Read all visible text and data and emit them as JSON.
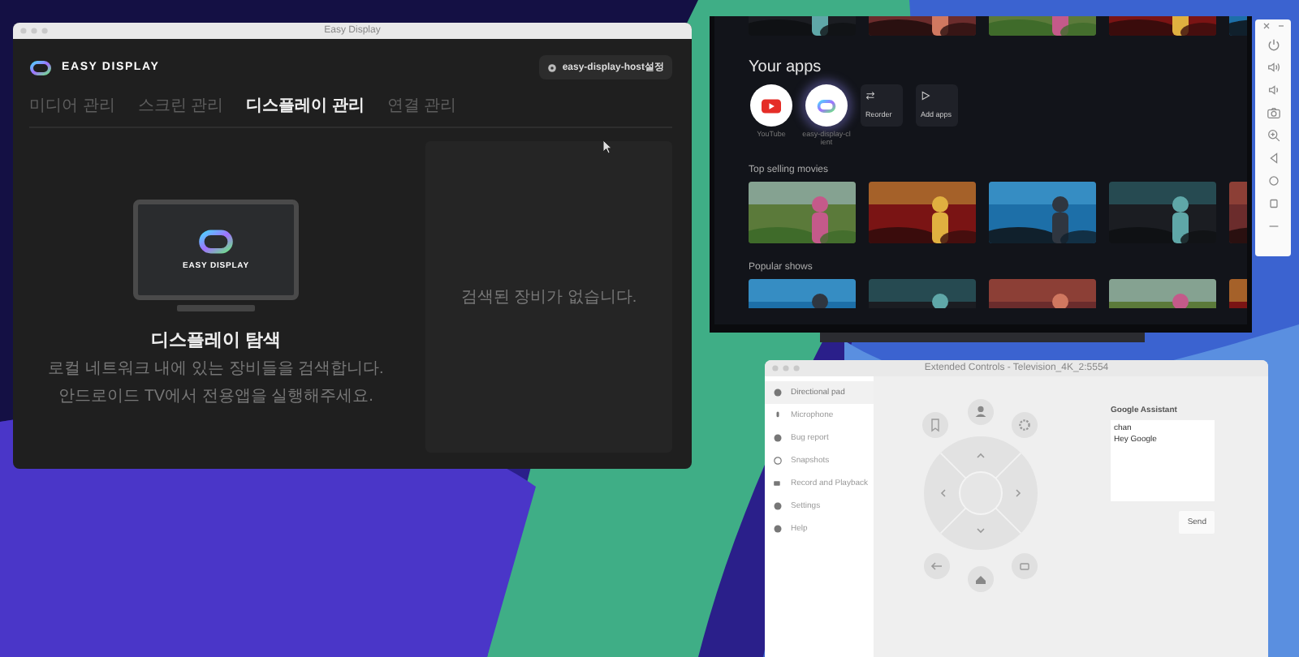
{
  "easy_display": {
    "title": "Easy Display",
    "brand": "EASY DISPLAY",
    "host_button": "easy-display-host설정",
    "tabs": [
      {
        "label": "미디어 관리",
        "selected": false
      },
      {
        "label": "스크린 관리",
        "selected": false
      },
      {
        "label": "디스플레이 관리",
        "selected": true
      },
      {
        "label": "연결 관리",
        "selected": false
      }
    ],
    "discovery": {
      "tv_brand": "EASY DISPLAY",
      "heading": "디스플레이 탐색",
      "lines": [
        "로컬 네트워크 내에 있는 장비들을 검색합니다.",
        "안드로이드 TV에서 전용앱을 실행해주세요."
      ]
    },
    "empty_message": "검색된 장비가 없습니다."
  },
  "tv": {
    "apps_heading": "Your apps",
    "apps": [
      {
        "kind": "youtube",
        "label": "YouTube"
      },
      {
        "kind": "client",
        "label": "easy-display-client"
      },
      {
        "kind": "reorder",
        "label": "Reorder"
      },
      {
        "kind": "add",
        "label": "Add apps"
      }
    ],
    "rows": [
      {
        "title": "Top selling movies"
      },
      {
        "title": "Popular shows"
      }
    ]
  },
  "extended_controls": {
    "title": "Extended Controls - Television_4K_2:5554",
    "sidebar": [
      {
        "label": "Directional pad",
        "selected": true
      },
      {
        "label": "Microphone",
        "selected": false
      },
      {
        "label": "Bug report",
        "selected": false
      },
      {
        "label": "Snapshots",
        "selected": false
      },
      {
        "label": "Record and Playback",
        "selected": false
      },
      {
        "label": "Settings",
        "selected": false
      },
      {
        "label": "Help",
        "selected": false
      }
    ],
    "assistant_label": "Google Assistant",
    "assistant_value": "chan\nHey Google",
    "send_button": "Send"
  }
}
